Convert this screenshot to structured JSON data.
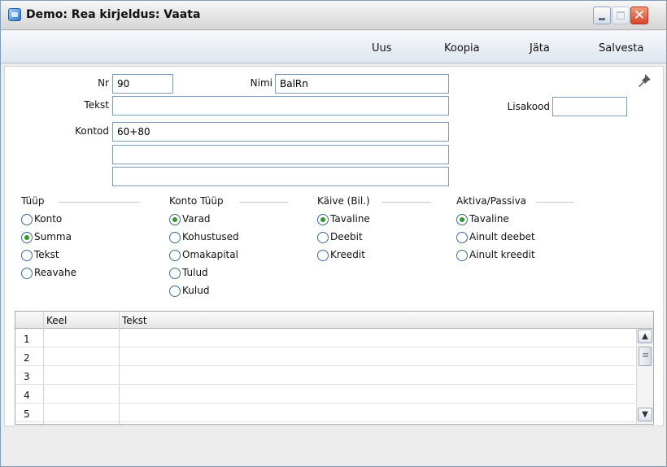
{
  "window": {
    "title": "Demo: Rea kirjeldus: Vaata"
  },
  "toolbar": {
    "new": "Uus",
    "copy": "Koopia",
    "skip": "Jäta",
    "save": "Salvesta"
  },
  "form": {
    "nr_label": "Nr",
    "nr_value": "90",
    "name_label": "Nimi",
    "name_value": "BalRn",
    "text_label": "Tekst",
    "text_value": "",
    "addcode_label": "Lisakood",
    "addcode_value": "",
    "accounts_label": "Kontod",
    "accounts": [
      "60+80",
      "",
      ""
    ]
  },
  "groups": {
    "type": {
      "title": "Tüüp",
      "options": [
        "Konto",
        "Summa",
        "Tekst",
        "Reavahe"
      ],
      "selected": 1
    },
    "account_type": {
      "title": "Konto Tüüp",
      "options": [
        "Varad",
        "Kohustused",
        "Omakapital",
        "Tulud",
        "Kulud"
      ],
      "selected": 0
    },
    "turnover": {
      "title": "Käive (Bil.)",
      "options": [
        "Tavaline",
        "Deebit",
        "Kreedit"
      ],
      "selected": 0
    },
    "assets_liabilities": {
      "title": "Aktiva/Passiva",
      "options": [
        "Tavaline",
        "Ainult deebet",
        "Ainult kreedit"
      ],
      "selected": 0
    }
  },
  "grid": {
    "columns": [
      "Keel",
      "Tekst"
    ],
    "rows": [
      {
        "num": "1",
        "lang": "",
        "text": ""
      },
      {
        "num": "2",
        "lang": "",
        "text": ""
      },
      {
        "num": "3",
        "lang": "",
        "text": ""
      },
      {
        "num": "4",
        "lang": "",
        "text": ""
      },
      {
        "num": "5",
        "lang": "",
        "text": ""
      }
    ]
  }
}
